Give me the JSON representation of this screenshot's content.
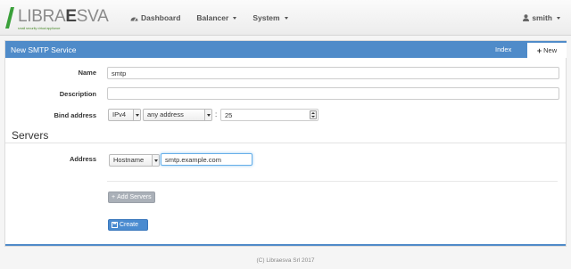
{
  "navbar": {
    "brand_light": "LIBRA",
    "brand_bold": "E",
    "brand_rest": "SVA",
    "tagline": "small security virtual appliance",
    "items": [
      {
        "label": "Dashboard",
        "icon": "dashboard-icon"
      },
      {
        "label": "Balancer",
        "icon": null
      },
      {
        "label": "System",
        "icon": null
      }
    ],
    "user": "smith"
  },
  "panel": {
    "title": "New SMTP Service",
    "tab_index": "Index",
    "tab_new": "New"
  },
  "form": {
    "name_label": "Name",
    "name_value": "smtp",
    "description_label": "Description",
    "description_value": "",
    "bind_label": "Bind address",
    "ip_version": "IPv4",
    "bind_address": "any address",
    "colon": ":",
    "port": "25"
  },
  "servers": {
    "title": "Servers",
    "address_label": "Address",
    "address_type": "Hostname",
    "address_value": "smtp.example.com",
    "add_button": "Add Servers",
    "create_button": "Create"
  },
  "footer": {
    "text": "(C) Libraesva Srl 2017"
  },
  "colors": {
    "accent": "#4f8bc9",
    "logo_green": "#3aa03a"
  }
}
